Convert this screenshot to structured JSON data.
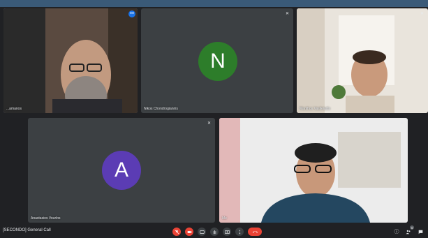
{
  "participants": [
    {
      "name": "...amanos",
      "type": "video",
      "speaking": true
    },
    {
      "name": "Nikos Chondrogiannis",
      "type": "avatar",
      "initial": "N",
      "avatar_color": "#2d7d2a"
    },
    {
      "name": "Manthos Vasileiadis",
      "type": "video"
    },
    {
      "name": "Anastasios Vourlos",
      "type": "avatar",
      "initial": "A",
      "avatar_color": "#5b3cb4"
    },
    {
      "name": "Me",
      "type": "video"
    }
  ],
  "meeting": {
    "title": "[SECONDO] General Call"
  },
  "controls": {
    "left": [
      "mic-off-icon",
      "camera-off-icon",
      "captions-icon",
      "raise-hand-icon",
      "present-icon",
      "more-options-icon",
      "hang-up-icon"
    ],
    "right": [
      "info-icon",
      "people-icon",
      "chat-icon"
    ],
    "people_count": "5"
  },
  "colors": {
    "accent": "#1a73e8",
    "danger": "#ea4335",
    "tile": "#3c4043",
    "background": "#202124"
  }
}
